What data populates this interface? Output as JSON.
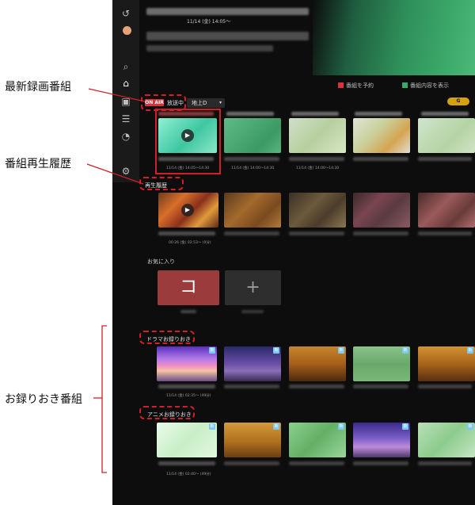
{
  "sidebar": {
    "icons": [
      "back-icon",
      "avatar",
      "search-icon",
      "home-icon",
      "recorded-icon",
      "guide-icon",
      "speed-icon",
      "settings-icon"
    ]
  },
  "header": {
    "datetime": "11/14 (金) 14:05〜"
  },
  "legend": {
    "reserve_label": "番組を予約",
    "details_label": "番組内容を表示",
    "reserve_color": "#d8333a",
    "details_color": "#3aa868"
  },
  "onair": {
    "badge": "ON AIR",
    "label": "放送中",
    "channel": "地上D",
    "guide_badge": "G",
    "items": [
      {
        "caption": "11/14 (金) 14:05〜14:30"
      },
      {
        "caption": "11/14 (金) 14:00〜14:30"
      },
      {
        "caption": "11/14 (金) 14:00〜14:30"
      },
      {
        "caption": ""
      },
      {
        "caption": ""
      }
    ]
  },
  "history": {
    "label": "再生履歴",
    "captions": [
      "00:26 (金) 02:53〜 (0分)",
      "",
      "",
      "",
      ""
    ]
  },
  "favorites": {
    "label": "お気に入り",
    "tile_char": "コ",
    "add_icon": "+"
  },
  "drama": {
    "label": "ドラマお録りおき",
    "captions": [
      "11/14 (金) 02:35〜 (49分)",
      "",
      "",
      "",
      ""
    ]
  },
  "anime": {
    "label": "アニメお録りおき",
    "captions": [
      "11/14 (金) 02:40〜 (49分)",
      "",
      "",
      "",
      ""
    ]
  },
  "annotations": {
    "latest": "最新録画番組",
    "history": "番組再生履歴",
    "saved": "お録りおき番組"
  }
}
